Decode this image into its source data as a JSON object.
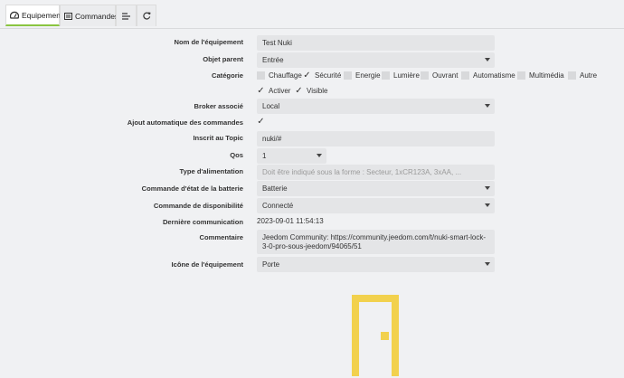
{
  "tabs": {
    "equipement": "Equipement",
    "commandes": "Commandes"
  },
  "form": {
    "nom_label": "Nom de l'équipement",
    "nom_value": "Test Nuki",
    "objet_label": "Objet parent",
    "objet_value": "Entrée",
    "categorie_label": "Catégorie",
    "categories": [
      {
        "label": "Chauffage",
        "checked": false
      },
      {
        "label": "Sécurité",
        "checked": true
      },
      {
        "label": "Energie",
        "checked": false
      },
      {
        "label": "Lumière",
        "checked": false
      },
      {
        "label": "Ouvrant",
        "checked": false
      },
      {
        "label": "Automatisme",
        "checked": false
      },
      {
        "label": "Multimédia",
        "checked": false
      },
      {
        "label": "Autre",
        "checked": false
      }
    ],
    "activer_label": "Activer",
    "visible_label": "Visible",
    "broker_label": "Broker associé",
    "broker_value": "Local",
    "ajout_label": "Ajout automatique des commandes",
    "topic_label": "Inscrit au Topic",
    "topic_value": "nuki/#",
    "qos_label": "Qos",
    "qos_value": "1",
    "alim_label": "Type d'alimentation",
    "alim_placeholder": "Doit être indiqué sous la forme : Secteur, 1xCR123A, 3xAA, ...",
    "batterie_label": "Commande d'état de la batterie",
    "batterie_value": "Batterie",
    "dispo_label": "Commande de disponibilité",
    "dispo_value": "Connecté",
    "derniere_label": "Dernière communication",
    "derniere_value": "2023-09-01 11:54:13",
    "commentaire_label": "Commentaire",
    "commentaire_line1": "Jeedom Community: https://community.jeedom.com/t/nuki-smart-lock-",
    "commentaire_line2": "3-0-pro-sous-jeedom/94065/51",
    "icone_label": "Icône de l'équipement",
    "icone_value": "Porte"
  },
  "colors": {
    "accent": "#8ac540",
    "door_icon": "#f2d14d"
  },
  "icons": {
    "equipement_tab": "tachometer-icon",
    "commandes_tab": "list-alt-icon",
    "advanced_tab": "list-icon",
    "refresh_tab": "refresh-icon",
    "door_preview": "door-icon"
  }
}
